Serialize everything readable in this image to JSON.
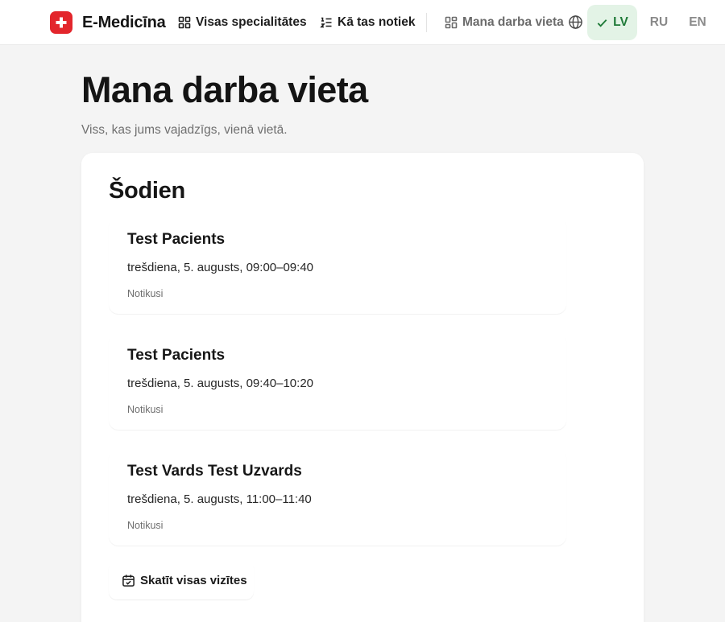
{
  "brand": {
    "name": "E-Medicīna",
    "logo_icon": "medical-cross-icon",
    "accent_color": "#e3262c"
  },
  "nav": {
    "specialties_label": "Visas specialitātes",
    "how_it_works_label": "Kā tas notiek",
    "workplace_label": "Mana darba vieta"
  },
  "languages": {
    "icon": "globe-icon",
    "items": [
      {
        "code": "LV",
        "selected": true
      },
      {
        "code": "RU",
        "selected": false
      },
      {
        "code": "EN",
        "selected": false
      }
    ],
    "selected_color": "#1f7a38"
  },
  "page": {
    "title": "Mana darba vieta",
    "subtitle": "Viss, kas jums vajadzīgs, vienā vietā."
  },
  "today": {
    "title": "Šodien",
    "appointments": [
      {
        "patient": "Test Pacients",
        "time": "trešdiena, 5. augusts, 09:00–09:40",
        "status": "Notikusi"
      },
      {
        "patient": "Test Pacients",
        "time": "trešdiena, 5. augusts, 09:40–10:20",
        "status": "Notikusi"
      },
      {
        "patient": "Test Vards Test Uzvards",
        "time": "trešdiena, 5. augusts, 11:00–11:40",
        "status": "Notikusi"
      }
    ],
    "view_all_label": "Skatīt visas vizītes",
    "view_all_icon": "calendar-check-icon"
  }
}
